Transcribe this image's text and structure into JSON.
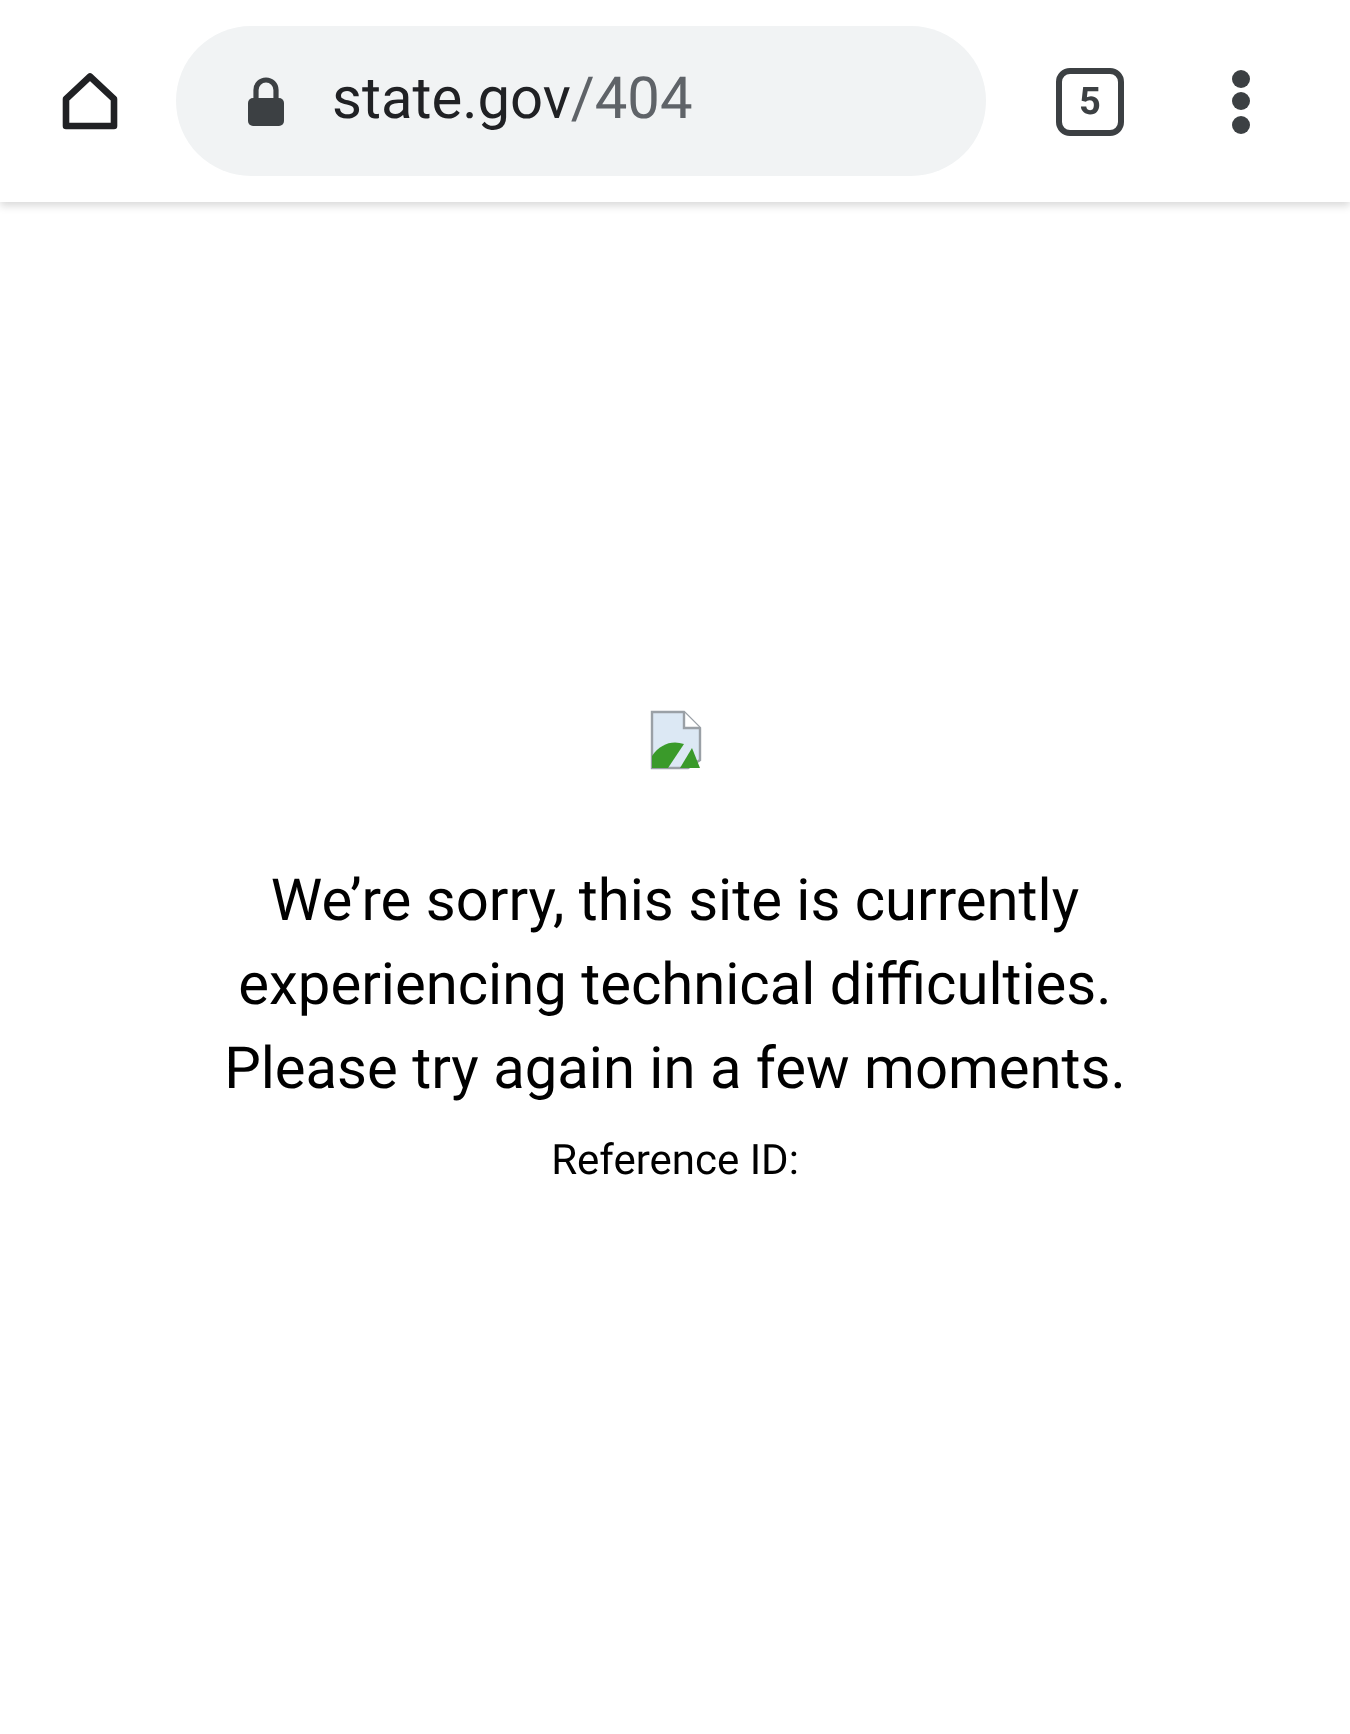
{
  "toolbar": {
    "url_domain": "state.gov",
    "url_path": "/404",
    "tab_count": "5"
  },
  "page": {
    "image": {
      "kind": "broken-image"
    },
    "message_lines": [
      "We’re sorry, this site is currently",
      "experiencing technical difficulties.",
      "Please try again in a few moments."
    ],
    "reference": "Reference ID:"
  }
}
